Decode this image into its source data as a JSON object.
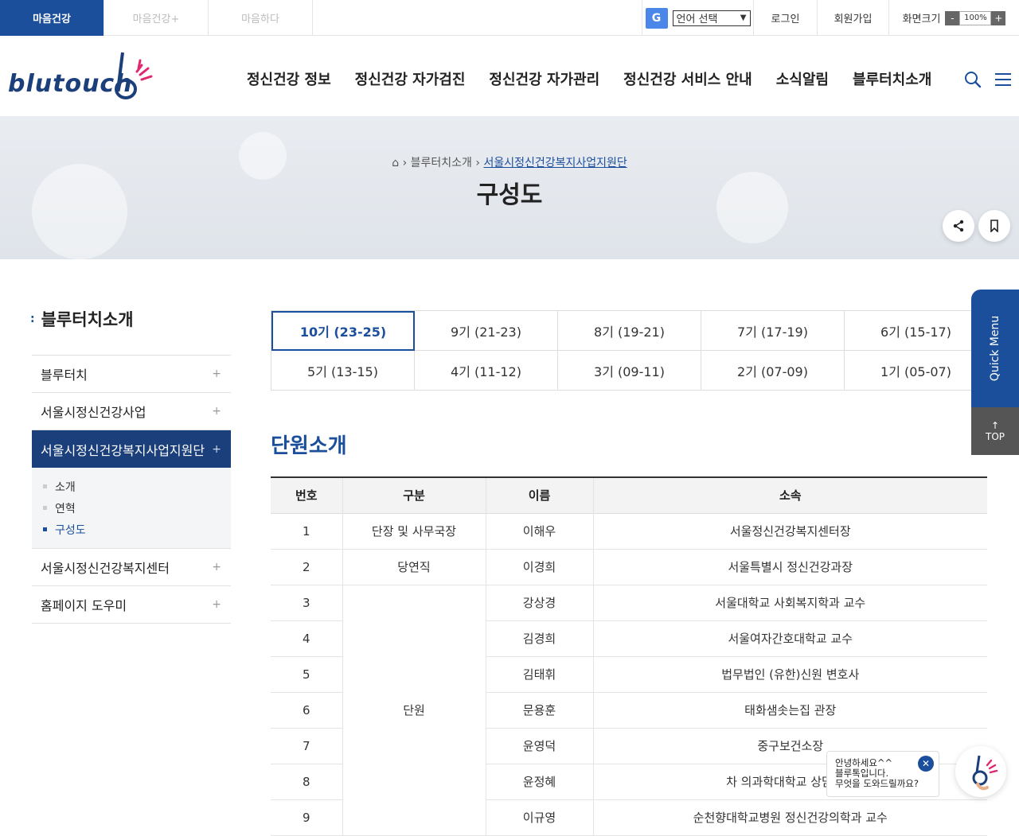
{
  "topbar": {
    "tabs": [
      "마음건강",
      "마음건강+",
      "마음하다"
    ],
    "lang_icon": "G",
    "lang_select": "언어 선택",
    "login": "로그인",
    "signup": "회원가입",
    "zoom_label": "화면크기",
    "zoom_minus": "-",
    "zoom_value": "100%",
    "zoom_plus": "+"
  },
  "header": {
    "logo_text": "blutouch",
    "nav": [
      "정신건강 정보",
      "정신건강 자가검진",
      "정신건강 자가관리",
      "정신건강 서비스 안내",
      "소식알림",
      "블루터치소개"
    ]
  },
  "banner": {
    "crumb_1": "블루터치소개",
    "crumb_2": "서울시정신건강복지사업지원단",
    "title": "구성도"
  },
  "lnb": {
    "title": "블루터치소개",
    "items": [
      "블루터치",
      "서울시정신건강사업",
      "서울시정신건강복지사업지원단",
      "서울시정신건강복지센터",
      "홈페이지 도우미"
    ],
    "sub": [
      "소개",
      "연혁",
      "구성도"
    ],
    "plus": "+"
  },
  "generations": [
    "10기 (23-25)",
    "9기 (21-23)",
    "8기 (19-21)",
    "7기 (17-19)",
    "6기 (15-17)",
    "5기 (13-15)",
    "4기 (11-12)",
    "3기 (09-11)",
    "2기 (07-09)",
    "1기 (05-07)"
  ],
  "section_title": "단원소개",
  "table": {
    "headers": [
      "번호",
      "구분",
      "이름",
      "소속"
    ],
    "rows": [
      {
        "no": "1",
        "cat": "단장 및 사무국장",
        "name": "이해우",
        "org": "서울정신건강복지센터장"
      },
      {
        "no": "2",
        "cat": "당연직",
        "name": "이경희",
        "org": "서울특별시 정신건강과장"
      },
      {
        "no": "3",
        "cat": "단원",
        "name": "강상경",
        "org": "서울대학교 사회복지학과 교수"
      },
      {
        "no": "4",
        "name": "김경희",
        "org": "서울여자간호대학교 교수"
      },
      {
        "no": "5",
        "name": "김태휘",
        "org": "법무법인 (유한)신원 변호사"
      },
      {
        "no": "6",
        "name": "문용훈",
        "org": "태화샘솟는집 관장"
      },
      {
        "no": "7",
        "name": "윤영덕",
        "org": "중구보건소장"
      },
      {
        "no": "8",
        "name": "윤정혜",
        "org": "차 의과학대학교 상담심리"
      },
      {
        "no": "9",
        "name": "이규영",
        "org": "순천향대학교병원 정신건강의학과 교수"
      }
    ]
  },
  "quick": {
    "label": "Quick Menu",
    "top": "TOP",
    "top_arrow": "↑"
  },
  "chat": {
    "line1": "안녕하세요^^",
    "line2": "블루톡입니다.",
    "line3": "무엇을 도와드릴까요?",
    "close": "✕"
  }
}
